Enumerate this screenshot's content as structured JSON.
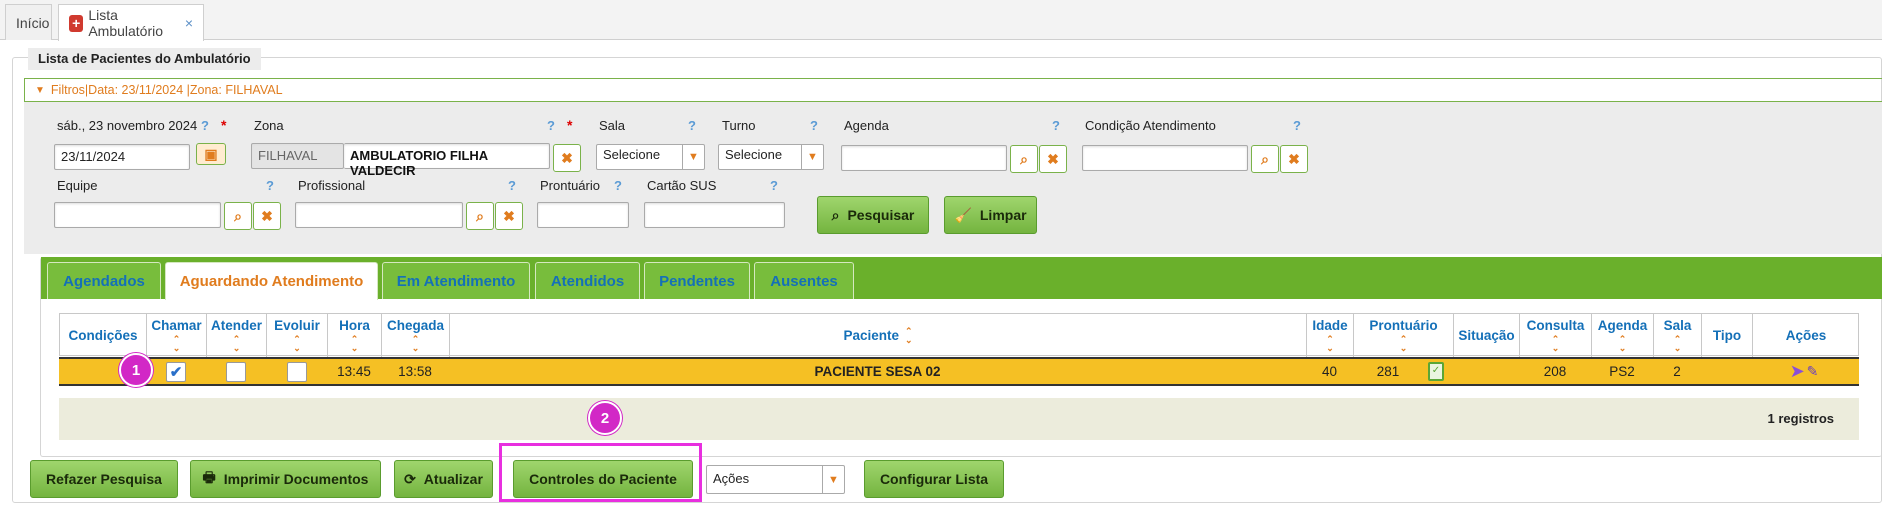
{
  "tabs": {
    "home": "Início",
    "active": "Lista Ambulatório",
    "close": "×"
  },
  "panel_title": "Lista de Pacientes do Ambulatório",
  "filter_summary": "Filtros|Data: 23/11/2024 |Zona: FILHAVAL",
  "form": {
    "date_label": "sáb., 23 novembro 2024",
    "date_value": "23/11/2024",
    "zona_label": "Zona",
    "zona_code": "FILHAVAL",
    "zona_name": "AMBULATORIO FILHA VALDECIR",
    "sala_label": "Sala",
    "sala_value": "Selecione",
    "turno_label": "Turno",
    "turno_value": "Selecione",
    "agenda_label": "Agenda",
    "condicao_label": "Condição Atendimento",
    "equipe_label": "Equipe",
    "profissional_label": "Profissional",
    "prontuario_label": "Prontuário",
    "cartao_label": "Cartão SUS",
    "help": "?",
    "required": "*",
    "pesquisar": "Pesquisar",
    "limpar": "Limpar"
  },
  "inner_tabs": [
    "Agendados",
    "Aguardando Atendimento",
    "Em Atendimento",
    "Atendidos",
    "Pendentes",
    "Ausentes"
  ],
  "columns": [
    "Condições",
    "Chamar",
    "Atender",
    "Evoluir",
    "Hora",
    "Chegada",
    "Paciente",
    "Idade",
    "Prontuário",
    "Situação",
    "Consulta",
    "Agenda",
    "Sala",
    "Tipo",
    "Ações"
  ],
  "row": {
    "chamar_checked": true,
    "hora": "13:45",
    "chegada": "13:58",
    "paciente": "PACIENTE SESA 02",
    "idade": "40",
    "prontuario": "281",
    "consulta": "208",
    "agenda": "PS2",
    "sala": "2"
  },
  "records": "1 registros",
  "markers": [
    "1",
    "2"
  ],
  "bottom": {
    "refazer": "Refazer Pesquisa",
    "imprimir": "Imprimir Documentos",
    "atualizar": "Atualizar",
    "controles": "Controles do Paciente",
    "acoes": "Ações",
    "configurar": "Configurar Lista"
  },
  "colors": {
    "green": "#6ab02b",
    "orange": "#e07c1e",
    "blue": "#1470b8",
    "highlight_row": "#f5c024",
    "marker": "#d228c6"
  }
}
